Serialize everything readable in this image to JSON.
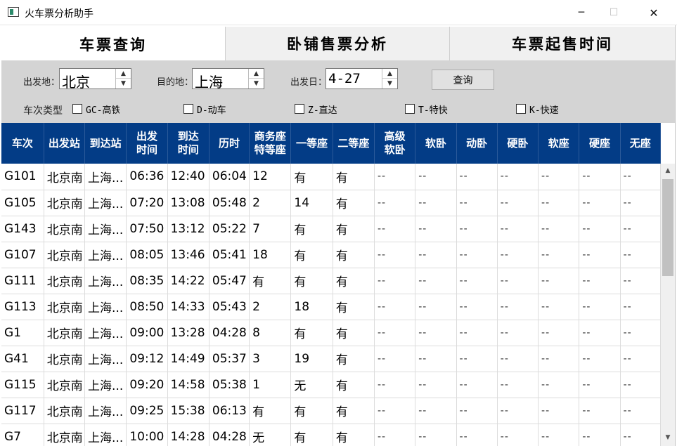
{
  "window": {
    "title": "火车票分析助手",
    "minimize": "─",
    "maximize": "☐",
    "close": "✕"
  },
  "tabs": [
    {
      "label": "车票查询",
      "active": true
    },
    {
      "label": "卧铺售票分析",
      "active": false
    },
    {
      "label": "车票起售时间",
      "active": false
    }
  ],
  "query": {
    "from_label": "出发地：",
    "from_value": "北京",
    "to_label": "目的地：",
    "to_value": "上海",
    "date_label": "出发日：",
    "date_value": "4-27",
    "query_button": "查询",
    "train_type_label": "车次类型",
    "train_types": [
      {
        "label": "GC-高铁",
        "checked": false
      },
      {
        "label": "D-动车",
        "checked": false
      },
      {
        "label": "Z-直达",
        "checked": false
      },
      {
        "label": "T-特快",
        "checked": false
      },
      {
        "label": "K-快速",
        "checked": false
      }
    ]
  },
  "table": {
    "columns": [
      "车次",
      "出发站",
      "到达站",
      "出发时间",
      "到达时间",
      "历时",
      "商务座特等座",
      "一等座",
      "二等座",
      "高级软卧",
      "软卧",
      "动卧",
      "硬卧",
      "软座",
      "硬座",
      "无座"
    ],
    "rows": [
      [
        "G101",
        "北京南",
        "上海...",
        "06:36",
        "12:40",
        "06:04",
        "12",
        "有",
        "有",
        "--",
        "--",
        "--",
        "--",
        "--",
        "--",
        "--"
      ],
      [
        "G105",
        "北京南",
        "上海...",
        "07:20",
        "13:08",
        "05:48",
        "2",
        "14",
        "有",
        "--",
        "--",
        "--",
        "--",
        "--",
        "--",
        "--"
      ],
      [
        "G143",
        "北京南",
        "上海...",
        "07:50",
        "13:12",
        "05:22",
        "7",
        "有",
        "有",
        "--",
        "--",
        "--",
        "--",
        "--",
        "--",
        "--"
      ],
      [
        "G107",
        "北京南",
        "上海...",
        "08:05",
        "13:46",
        "05:41",
        "18",
        "有",
        "有",
        "--",
        "--",
        "--",
        "--",
        "--",
        "--",
        "--"
      ],
      [
        "G111",
        "北京南",
        "上海...",
        "08:35",
        "14:22",
        "05:47",
        "有",
        "有",
        "有",
        "--",
        "--",
        "--",
        "--",
        "--",
        "--",
        "--"
      ],
      [
        "G113",
        "北京南",
        "上海...",
        "08:50",
        "14:33",
        "05:43",
        "2",
        "18",
        "有",
        "--",
        "--",
        "--",
        "--",
        "--",
        "--",
        "--"
      ],
      [
        "G1",
        "北京南",
        "上海...",
        "09:00",
        "13:28",
        "04:28",
        "8",
        "有",
        "有",
        "--",
        "--",
        "--",
        "--",
        "--",
        "--",
        "--"
      ],
      [
        "G41",
        "北京南",
        "上海...",
        "09:12",
        "14:49",
        "05:37",
        "3",
        "19",
        "有",
        "--",
        "--",
        "--",
        "--",
        "--",
        "--",
        "--"
      ],
      [
        "G115",
        "北京南",
        "上海...",
        "09:20",
        "14:58",
        "05:38",
        "1",
        "无",
        "有",
        "--",
        "--",
        "--",
        "--",
        "--",
        "--",
        "--"
      ],
      [
        "G117",
        "北京南",
        "上海...",
        "09:25",
        "15:38",
        "06:13",
        "有",
        "有",
        "有",
        "--",
        "--",
        "--",
        "--",
        "--",
        "--",
        "--"
      ],
      [
        "G7",
        "北京南",
        "上海...",
        "10:00",
        "14:28",
        "04:28",
        "无",
        "有",
        "有",
        "--",
        "--",
        "--",
        "--",
        "--",
        "--",
        "--"
      ]
    ]
  },
  "icons": {
    "app": "app-icon",
    "spin_up": "▲",
    "spin_down": "▼",
    "scroll_up": "▲",
    "scroll_down": "▼"
  },
  "colors": {
    "header_bg": "#033c86",
    "panel_bg": "#d4d4d4",
    "tab_bg": "#f0f0f0"
  }
}
